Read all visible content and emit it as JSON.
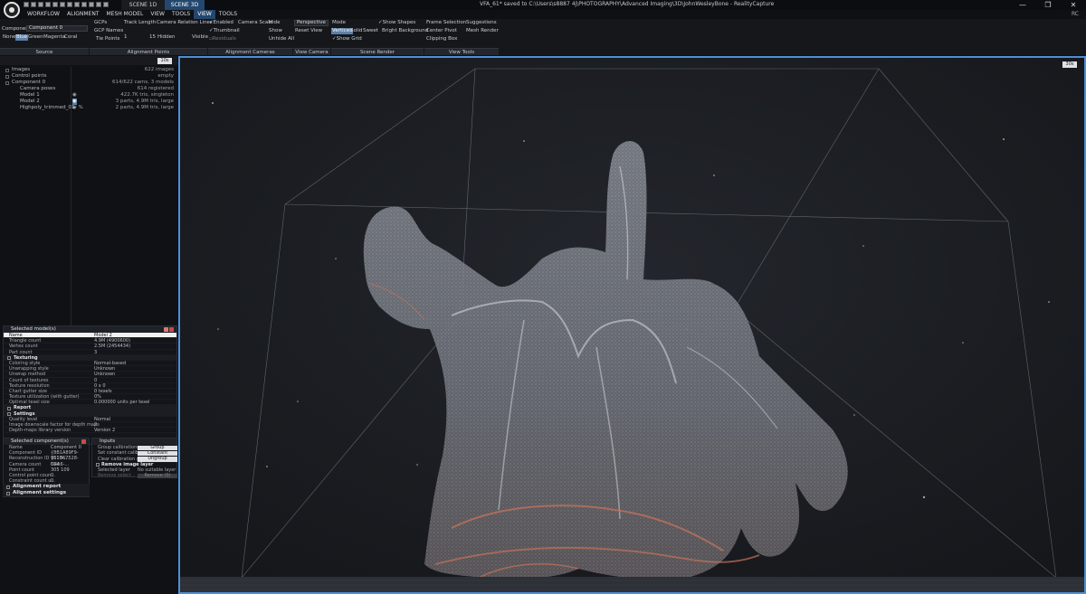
{
  "window": {
    "title": "VFA_61* saved to C:\\Users\\s8887 4j\\PHOTOGRAPHY\\Advanced Imaging\\3D\\JohnWesleyBone - RealityCapture",
    "scene_tabs": [
      "SCENE 1D",
      "SCENE 3D"
    ],
    "controls": [
      "—",
      "❐",
      "✕"
    ],
    "user_badge": "RC"
  },
  "menu": {
    "items": [
      "WORKFLOW",
      "ALIGNMENT",
      "MESH MODEL",
      "VIEW",
      "TOOLS",
      "VIEW",
      "TOOLS"
    ],
    "active_index": 5
  },
  "ribbon": {
    "component_label": "Component",
    "component_value": "Component 0",
    "colors": [
      "None",
      "Blue",
      "Green",
      "Magenta",
      "Coral"
    ],
    "gcps": "GCPs",
    "gcp_names": "GCP Names",
    "tie_points": "Tie Points",
    "track_length": "Track Length",
    "track_value": "1",
    "cam_rel_lines": "Camera Relation Lines",
    "hidden_value": "15",
    "hidden": "Hidden",
    "visible": "Visible",
    "enabled": "Enabled",
    "thumbnail": "Thumbnail",
    "residuals": "Residuals",
    "camera_scale": "Camera Scale",
    "hide": "Hide",
    "show": "Show",
    "unhide_all": "Unhide All",
    "perspective": "Perspective",
    "reset_view": "Reset View",
    "mode": "Mode",
    "vertices": "Vertices",
    "solid": "Solid",
    "sweet": "Sweet",
    "show_grid": "Show Grid",
    "show_shapes": "Show Shapes",
    "bright_background": "Bright Background",
    "frame_selection": "Frame Selection",
    "suggestions": "Suggestions",
    "center_pivot": "Center Pivot",
    "mesh_render": "Mesh Render",
    "clipping_box": "Clipping Box",
    "groups": [
      "Source",
      "Alignment Points",
      "Alignment Cameras",
      "View Camera",
      "Scene Render",
      "View Tools"
    ]
  },
  "left_panel": {
    "button_10s": "10s",
    "tree": [
      {
        "label": "Images",
        "value": "622 images",
        "sub": false
      },
      {
        "label": "Control points",
        "value": "empty",
        "sub": false
      },
      {
        "label": "Component 0",
        "value": "614/622 cams, 3 models",
        "sub": false
      },
      {
        "label": "Camera poses",
        "value": "614 registered",
        "sub": true
      },
      {
        "label": "Model 1",
        "value": "422.7K tris, singleton",
        "sub": true
      },
      {
        "label": "Model 2",
        "value": "3 parts, 4.9M tris, large",
        "sub": true
      },
      {
        "label": "Highpoly_trimmed_01",
        "value": "2 parts, 4.9M tris, large",
        "sub": true
      }
    ]
  },
  "model_props": {
    "title": "Selected model(s)",
    "rows": [
      {
        "k": "Name",
        "v": "Model 2",
        "type": "selected"
      },
      {
        "k": "Triangle count",
        "v": "4.9M (4900600)",
        "type": "row"
      },
      {
        "k": "Vertex count",
        "v": "2.5M (2454434)",
        "type": "row"
      },
      {
        "k": "Part count",
        "v": "3",
        "type": "row"
      },
      {
        "k": "Texturing",
        "v": "",
        "type": "section"
      },
      {
        "k": "Coloring style",
        "v": "Normal-based",
        "type": "row"
      },
      {
        "k": "Unwrapping style",
        "v": "Unknown",
        "type": "row"
      },
      {
        "k": "Unwrap method",
        "v": "Unknown",
        "type": "row"
      },
      {
        "k": "Count of textures",
        "v": "0",
        "type": "row"
      },
      {
        "k": "Texture resolution",
        "v": "0 x 0",
        "type": "row"
      },
      {
        "k": "Chart gutter size",
        "v": "0 texels",
        "type": "row"
      },
      {
        "k": "Texture utilization (with gutter)",
        "v": "0%",
        "type": "row"
      },
      {
        "k": "Optimal texel size",
        "v": "0.000000 units per texel",
        "type": "row"
      },
      {
        "k": "Report",
        "v": "",
        "type": "section"
      },
      {
        "k": "Settings",
        "v": "",
        "type": "section"
      },
      {
        "k": "Quality level",
        "v": "Normal",
        "type": "row"
      },
      {
        "k": "Image downscale factor for depth maps",
        "v": "2",
        "type": "row"
      },
      {
        "k": "Depth-maps library version",
        "v": "Version 2",
        "type": "row"
      }
    ]
  },
  "component_props": {
    "title": "Selected component(s)",
    "rows": [
      {
        "k": "Name",
        "v": "Component 0"
      },
      {
        "k": "Component ID",
        "v": "{8B1A89F9-9E1D-..."
      },
      {
        "k": "Reconstruction ID",
        "v": "{61B67528-D4A6-..."
      },
      {
        "k": "Camera count",
        "v": "614"
      },
      {
        "k": "Point count",
        "v": "305 109"
      },
      {
        "k": "Control point coun...",
        "v": "0"
      },
      {
        "k": "Constraint count u...",
        "v": "0"
      }
    ]
  },
  "inputs_panel": {
    "title": "Inputs",
    "rows": [
      {
        "k": "Group calibrations...",
        "b": "Group",
        "type": "btn"
      },
      {
        "k": "Set constant calibr...",
        "b": "Constant",
        "type": "btn"
      },
      {
        "k": "Clear calibration g...",
        "b": "Ungroup",
        "type": "btn"
      },
      {
        "k": "Remove image layer",
        "b": "",
        "type": "section"
      },
      {
        "k": "Selected layer",
        "v": "No suitable layer",
        "type": "val"
      },
      {
        "k": "Remove select...",
        "b": "Remove (0)",
        "type": "dim"
      }
    ]
  },
  "bottom_sections": [
    "Alignment report",
    "Alignment settings"
  ],
  "viewport": {
    "button_30s": "30s"
  },
  "colors": {
    "accent": "#4d8fd6",
    "active_tab": "#24476e",
    "point_cloud": "#b9bcc2",
    "point_cloud_warm": "#c4735a"
  }
}
